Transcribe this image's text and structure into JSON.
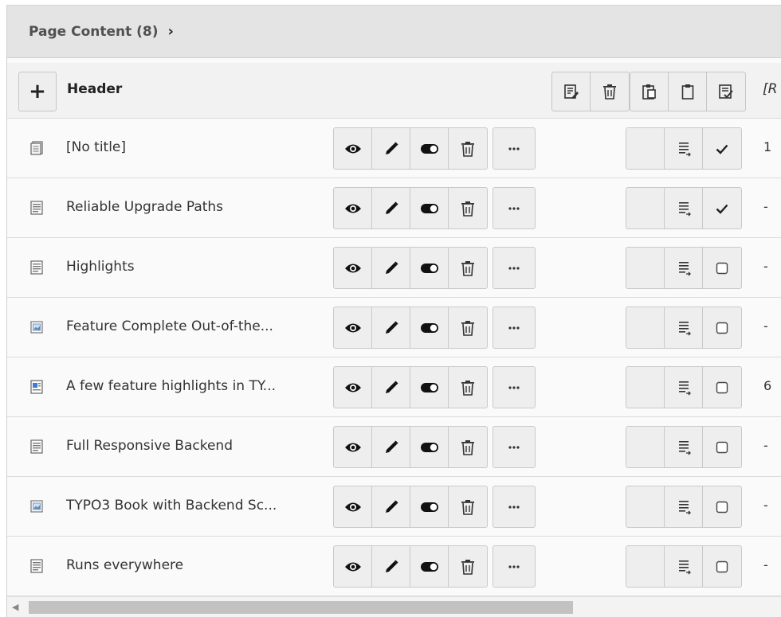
{
  "panel": {
    "title": "Page Content (8)",
    "chevron": "›"
  },
  "table_head": {
    "add": "+",
    "label": "Header",
    "group1_icons": [
      "edit-selected-icon",
      "delete-selected-icon"
    ],
    "group2_icons": [
      "paste-icon",
      "clipboard-icon",
      "edit-clipboard-icon"
    ],
    "extra": "[R"
  },
  "rows": [
    {
      "title": "[No title]",
      "icon": "content-shortcut-icon",
      "check": "checked-icon",
      "num": "1"
    },
    {
      "title": "Reliable Upgrade Paths",
      "icon": "content-text-icon",
      "check": "checked-icon",
      "num": "-"
    },
    {
      "title": "Highlights",
      "icon": "content-text-icon",
      "check": "checkbox-icon",
      "num": "-"
    },
    {
      "title": "Feature Complete Out-of-the...",
      "icon": "content-image-icon",
      "check": "checkbox-icon",
      "num": "-"
    },
    {
      "title": "A few feature highlights in TY...",
      "icon": "content-textpic-icon",
      "check": "checkbox-icon",
      "num": "6"
    },
    {
      "title": "Full Responsive Backend",
      "icon": "content-text-icon",
      "check": "checkbox-icon",
      "num": "-"
    },
    {
      "title": "TYPO3 Book with Backend Sc...",
      "icon": "content-image-icon",
      "check": "checkbox-icon",
      "num": "-"
    },
    {
      "title": "Runs everywhere",
      "icon": "content-text-icon",
      "check": "checkbox-icon",
      "num": "-"
    }
  ],
  "row_action_icons": [
    "eye-icon",
    "pencil-icon",
    "toggle-icon",
    "trash-icon",
    "more-icon",
    "blank-slot",
    "list-clipboard-icon"
  ],
  "scrollbar": {
    "arrow": "◀"
  }
}
